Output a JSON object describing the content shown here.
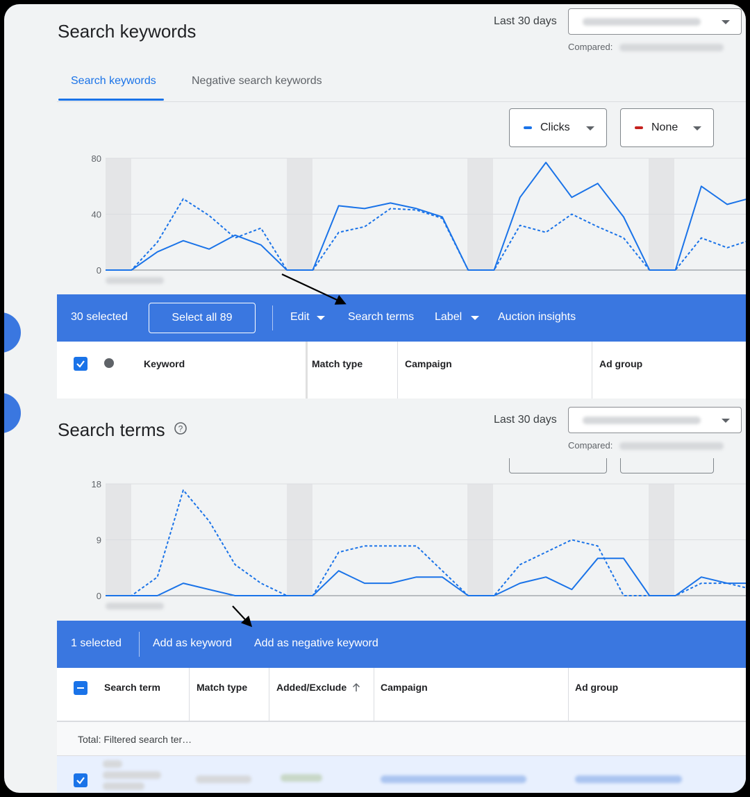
{
  "keywords_section": {
    "title": "Search keywords",
    "period_label": "Last 30 days",
    "compared_label": "Compared:",
    "tabs": [
      {
        "label": "Search keywords",
        "active": true
      },
      {
        "label": "Negative search keywords",
        "active": false
      }
    ],
    "metric_primary": {
      "label": "Clicks",
      "color": "#1a73e8"
    },
    "metric_secondary": {
      "label": "None",
      "color": "#c5221f"
    }
  },
  "keywords_actionbar": {
    "selected": "30 selected",
    "select_all": "Select all 89",
    "edit": "Edit",
    "search_terms": "Search terms",
    "label": "Label",
    "auction_insights": "Auction insights"
  },
  "keywords_table": {
    "headers": [
      "Keyword",
      "Match type",
      "Campaign",
      "Ad group"
    ]
  },
  "terms_section": {
    "title": "Search terms",
    "help_icon": "help-circle-icon",
    "period_label": "Last 30 days",
    "compared_label": "Compared:"
  },
  "terms_actionbar": {
    "selected": "1 selected",
    "add_keyword": "Add as keyword",
    "add_negative": "Add as negative keyword"
  },
  "terms_table": {
    "headers": [
      "Search term",
      "Match type",
      "Added/Exclude‹",
      "Campaign",
      "Ad group"
    ],
    "total_label": "Total: Filtered search ter…"
  },
  "colors": {
    "accent": "#1a73e8",
    "actionbar": "#3a77e0"
  },
  "chart_data": [
    {
      "type": "line",
      "title": "",
      "ylim": [
        0,
        80
      ],
      "yticks": [
        0,
        40,
        80
      ],
      "x": [
        1,
        2,
        3,
        4,
        5,
        6,
        7,
        8,
        9,
        10,
        11,
        12,
        13,
        14,
        15,
        16,
        17,
        18,
        19,
        20,
        21,
        22,
        23,
        24,
        25,
        26,
        27,
        28,
        29,
        30
      ],
      "series": [
        {
          "style": "solid",
          "values": [
            0,
            0,
            13,
            21,
            15,
            25,
            18,
            0,
            0,
            46,
            44,
            48,
            44,
            38,
            0,
            0,
            52,
            77,
            52,
            62,
            38,
            0,
            0,
            60,
            47,
            52
          ]
        },
        {
          "style": "dashed",
          "values": [
            0,
            0,
            20,
            51,
            39,
            23,
            30,
            0,
            0,
            27,
            31,
            44,
            43,
            37,
            0,
            0,
            32,
            27,
            40,
            31,
            23,
            0,
            0,
            23,
            16,
            22
          ]
        }
      ]
    },
    {
      "type": "line",
      "title": "",
      "ylim": [
        0,
        18
      ],
      "yticks": [
        0,
        9,
        18
      ],
      "series": [
        {
          "style": "solid",
          "values": [
            0,
            0,
            0,
            2,
            1,
            0,
            0,
            0,
            0,
            4,
            2,
            2,
            3,
            3,
            0,
            0,
            2,
            3,
            1,
            6,
            6,
            0,
            0,
            3,
            2,
            2
          ]
        },
        {
          "style": "dashed",
          "values": [
            0,
            0,
            3,
            17,
            12,
            5,
            2,
            0,
            0,
            7,
            8,
            8,
            8,
            4,
            0,
            0,
            5,
            7,
            9,
            8,
            0,
            0,
            0,
            2,
            2,
            1
          ]
        }
      ]
    }
  ]
}
